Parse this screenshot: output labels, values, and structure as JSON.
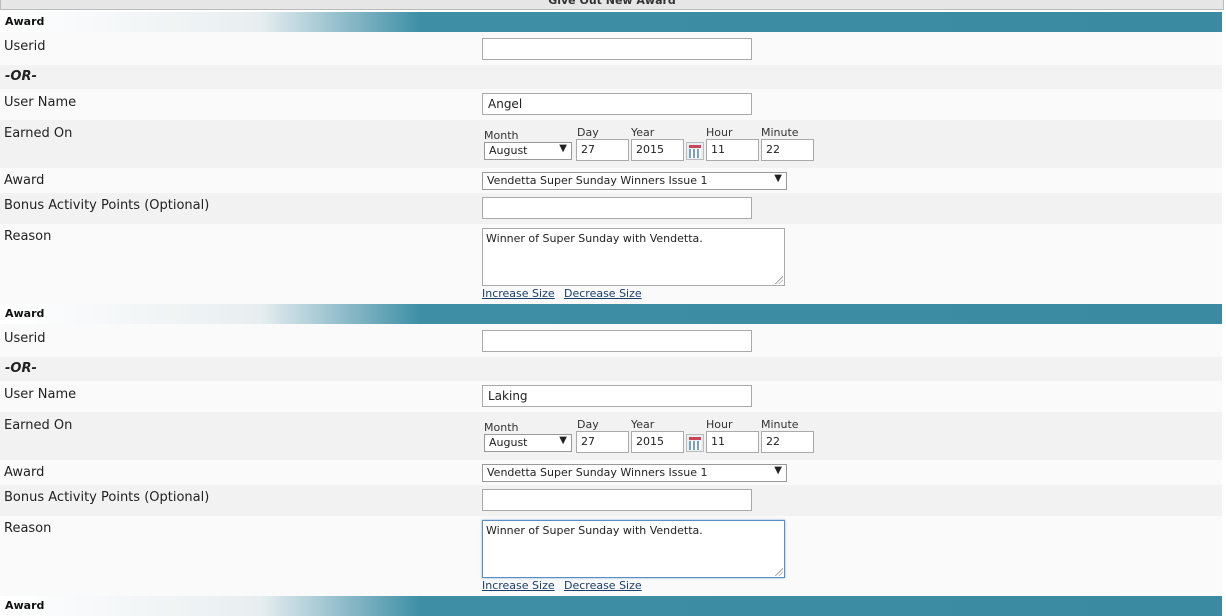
{
  "page_title": "Give Out New Award",
  "labels": {
    "userid": "Userid",
    "or": "-OR-",
    "user_name": "User Name",
    "earned_on": "Earned On",
    "award": "Award",
    "bonus": "Bonus Activity Points (Optional)",
    "reason": "Reason",
    "month": "Month",
    "day": "Day",
    "year": "Year",
    "hour": "Hour",
    "minute": "Minute",
    "increase": "Increase Size",
    "decrease": "Decrease Size"
  },
  "awards": [
    {
      "section_label": "Award",
      "userid": "",
      "user_name": "Angel",
      "month": "August",
      "day": "27",
      "year": "2015",
      "hour": "11",
      "minute": "22",
      "award": "Vendetta Super Sunday Winners Issue 1",
      "bonus": "",
      "reason": "Winner of Super Sunday with Vendetta."
    },
    {
      "section_label": "Award",
      "userid": "",
      "user_name": "Laking",
      "month": "August",
      "day": "27",
      "year": "2015",
      "hour": "11",
      "minute": "22",
      "award": "Vendetta Super Sunday Winners Issue 1",
      "bonus": "",
      "reason": "Winner of Super Sunday with Vendetta."
    },
    {
      "section_label": "Award"
    }
  ]
}
